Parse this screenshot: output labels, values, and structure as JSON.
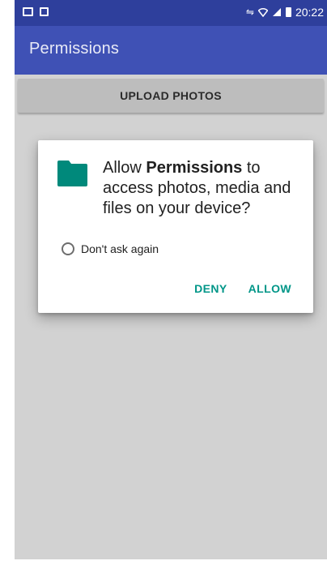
{
  "status_bar": {
    "time": "20:22",
    "left_icons": [
      "gallery-notification-icon",
      "screenshot-notification-icon"
    ],
    "right_icons": [
      "nfc-icon",
      "wifi-icon",
      "signal-icon",
      "battery-icon"
    ],
    "color": "#2e3f9c"
  },
  "app_bar": {
    "title": "Permissions",
    "color": "#3f51b5"
  },
  "main": {
    "upload_button_label": "UPLOAD PHOTOS",
    "background_color": "#d2d2d2"
  },
  "dialog": {
    "icon": "folder-icon",
    "message_prefix": "Allow ",
    "app_name": "Permissions",
    "message_suffix": " to access photos, media and files on your device?",
    "dont_ask_label": "Don't ask again",
    "dont_ask_checked": false,
    "deny_label": "DENY",
    "allow_label": "ALLOW",
    "accent_color": "#009688"
  }
}
